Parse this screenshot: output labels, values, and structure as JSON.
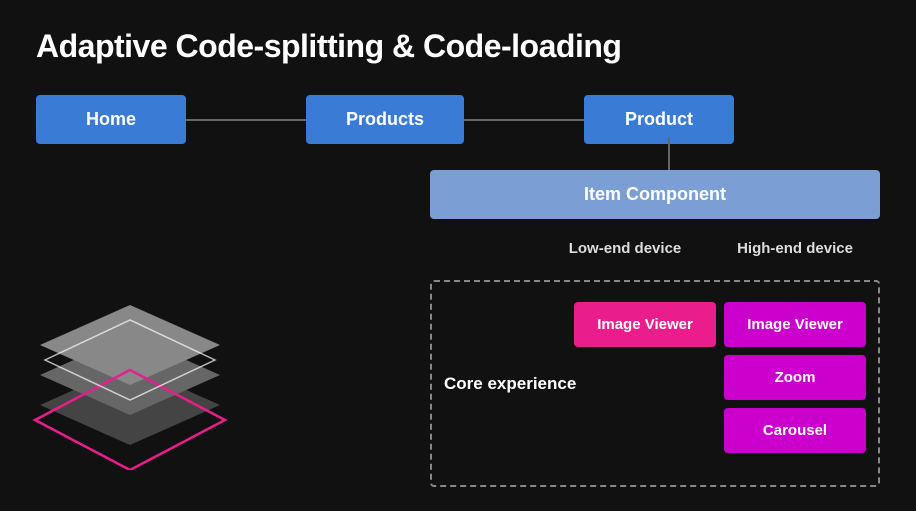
{
  "title": "Adaptive Code-splitting & Code-loading",
  "nav": {
    "home": "Home",
    "products": "Products",
    "product": "Product"
  },
  "item_component": "Item Component",
  "device_labels": {
    "low_end": "Low-end device",
    "high_end": "High-end device"
  },
  "core_experience": {
    "label": "Core experience",
    "low_end": {
      "image_viewer": "Image Viewer"
    },
    "high_end": {
      "image_viewer": "Image Viewer",
      "zoom": "Zoom",
      "carousel": "Carousel"
    }
  }
}
